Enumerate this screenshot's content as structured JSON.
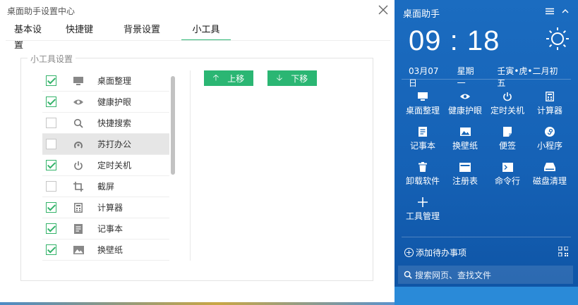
{
  "settings": {
    "title": "桌面助手设置中心",
    "tabs": [
      {
        "label": "基本设置"
      },
      {
        "label": "快捷键"
      },
      {
        "label": "背景设置"
      },
      {
        "label": "小工具",
        "active": true
      }
    ],
    "group_title": "小工具设置",
    "tools": [
      {
        "label": "桌面整理",
        "checked": true,
        "icon": "monitor-icon"
      },
      {
        "label": "健康护眼",
        "checked": true,
        "icon": "eye-icon"
      },
      {
        "label": "快捷搜索",
        "checked": false,
        "icon": "search-icon"
      },
      {
        "label": "苏打办公",
        "checked": false,
        "icon": "soda-office-icon",
        "highlighted": true
      },
      {
        "label": "定时关机",
        "checked": true,
        "icon": "power-icon"
      },
      {
        "label": "截屏",
        "checked": false,
        "icon": "crop-icon"
      },
      {
        "label": "计算器",
        "checked": true,
        "icon": "calculator-icon"
      },
      {
        "label": "记事本",
        "checked": true,
        "icon": "notepad-icon"
      },
      {
        "label": "换壁纸",
        "checked": true,
        "icon": "wallpaper-icon"
      },
      {
        "label": "",
        "checked": false,
        "icon": "partial-icon"
      }
    ],
    "move_up_label": "上移",
    "move_down_label": "下移"
  },
  "assistant": {
    "title": "桌面助手",
    "time": "09 : 18",
    "date": "03月07日",
    "weekday": "星期一",
    "lunar": "壬寅•虎•二月初五",
    "tools": [
      {
        "label": "桌面整理",
        "icon": "monitor-icon"
      },
      {
        "label": "健康护眼",
        "icon": "eye-icon"
      },
      {
        "label": "定时关机",
        "icon": "power-icon"
      },
      {
        "label": "计算器",
        "icon": "calculator-icon"
      },
      {
        "label": "记事本",
        "icon": "notepad-icon"
      },
      {
        "label": "换壁纸",
        "icon": "wallpaper-icon"
      },
      {
        "label": "便签",
        "icon": "sticky-note-icon"
      },
      {
        "label": "小程序",
        "icon": "mini-program-icon"
      },
      {
        "label": "卸载软件",
        "icon": "trash-icon"
      },
      {
        "label": "注册表",
        "icon": "registry-icon"
      },
      {
        "label": "命令行",
        "icon": "terminal-icon"
      },
      {
        "label": "磁盘清理",
        "icon": "disk-icon"
      },
      {
        "label": "工具管理",
        "icon": "plus-icon"
      }
    ],
    "todo_label": "添加待办事项",
    "search_placeholder": "搜索网页、查找文件"
  },
  "colors": {
    "accent_green": "#2bb673",
    "panel_blue": "#1565b8"
  }
}
